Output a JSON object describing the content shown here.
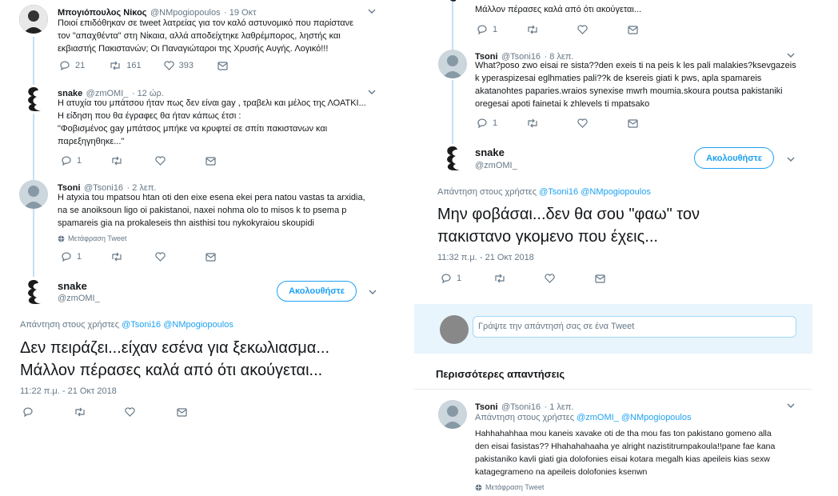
{
  "left": {
    "t1": {
      "name": "Μπογιόπουλος Νίκος",
      "handle": "@NMpogiopoulos",
      "time": "· 19 Οκτ",
      "lines": [
        "Ποιοί επιδόθηκαν σε tweet λατρείας για τον καλό αστυνομικό που παρίστανε",
        "τον \"απαχθέντα\" στη Νίκαια, αλλά αποδείχτηκε λαθρέμπορος, ληστής και",
        "εκβιαστής Πακιστανών; Οι Παναγιώταροι της Χρυσής Αυγής. Λογικό!!!"
      ],
      "replies": "21",
      "retweets": "161",
      "likes": "393"
    },
    "t2": {
      "name": "snake",
      "handle": "@zmOMI_",
      "time": "· 12 ώρ.",
      "lines": [
        "Η ατυχία του μπάτσου ήταν πως δεν είναι gay , τραβελι και μέλος της ΛΟΑΤΚΙ...",
        "Η είδηση που θα έγραφες θα ήταν κάπως έτσι :",
        "\"Φοβισμένος gay μπάτσος μπήκε να κρυφτεί σε σπίτι πακιστανων και",
        "παρεξηγηθηκε...\""
      ],
      "replies": "1"
    },
    "t3": {
      "name": "Tsoni",
      "handle": "@Tsoni16",
      "time": "· 2 λεπ.",
      "lines": [
        "H atyxia tou mpatsou htan oti den eixe esena ekei pera natou vastas ta arxidia,",
        "na se anoiksoun ligo oi pakistanoi, naxei nohma olo to misos k to psema p",
        "spamareis gia na prokaleseis thn aisthisi tou nykokyraiou skoupidi"
      ],
      "translate": "Μετάφραση Tweet",
      "replies": "1"
    },
    "main": {
      "name": "snake",
      "handle": "@zmOMI_",
      "follow": "Ακολουθήστε",
      "reply_prefix": "Απάντηση στους χρήστες",
      "reply_to1": "@Tsoni16",
      "reply_to2": "@NMpogiopoulos",
      "text1": "Δεν πειράζει...είχαν εσένα για ξεκωλιασμα...",
      "text2": "Μάλλον πέρασες καλά από ότι ακούγεται...",
      "timestamp": "11:22 π.μ. - 21 Οκτ 2018"
    }
  },
  "right": {
    "top": {
      "line": "Μάλλον πέρασες καλά από ότι ακούγεται...",
      "replies": "1"
    },
    "t1": {
      "name": "Tsoni",
      "handle": "@Tsoni16",
      "time": "· 8 λεπ.",
      "lines": [
        "What?poso zwo eisai re sista??den exeis ti na peis k les pali malakies?ksevgazeis",
        "k yperaspizesai eglhmaties pali??k de ksereis giati k pws, apla spamareis",
        "akatanohtes paparies.wraios synexise mwrh moumia.skoura poutsa pakistaniki",
        "oregesai apoti fainetai k zhlevels ti mpatsako"
      ],
      "replies": "1"
    },
    "main": {
      "name": "snake",
      "handle": "@zmOMI_",
      "follow": "Ακολουθήστε",
      "reply_prefix": "Απάντηση στους χρήστες",
      "reply_to1": "@Tsoni16",
      "reply_to2": "@NMpogiopoulos",
      "text1": "Μην φοβάσαι...δεν θα σου \"φαω\" τον",
      "text2": "πακιστανο γκομενο που έχεις...",
      "timestamp": "11:32 π.μ. - 21 Οκτ 2018",
      "replies": "1"
    },
    "compose_placeholder": "Γράψτε την απάντησή σας σε ένα Tweet",
    "more_replies": "Περισσότερες απαντήσεις",
    "t2": {
      "name": "Tsoni",
      "handle": "@Tsoni16",
      "time": "· 1 λεπ.",
      "reply_prefix": "Απάντηση στους χρήστες",
      "reply_to1": "@zmOMI_",
      "reply_to2": "@NMpogiopoulos",
      "lines": [
        "Hahhahahhaa mou kaneis xavake oti de tha mou fas ton pakistano gomeno alla",
        "den eisai fasistas?? Hhahahahaaha ye alright nazistitrumpakoula!!pane fae kana",
        "pakistaniko kavli giati gia dolofonies eisai kotara megalh kias apeileis kias sexw",
        "katagegrameno na apeileis dolofonies ksenwn"
      ],
      "translate": "Μετάφραση Tweet"
    }
  }
}
